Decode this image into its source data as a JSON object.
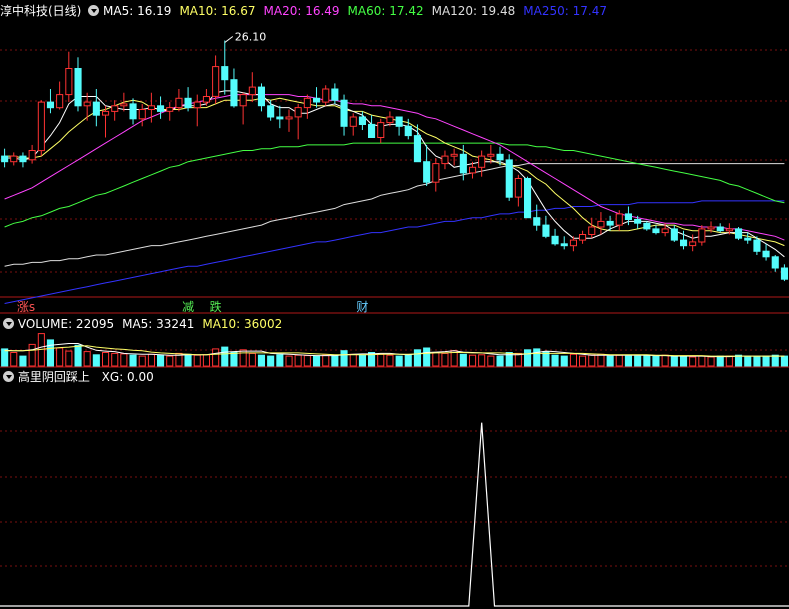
{
  "main": {
    "title": "淳中科技(日线)",
    "ma_items": [
      {
        "label": "MA5: 16.19",
        "color": "#ffffff"
      },
      {
        "label": "MA10: 16.67",
        "color": "#ffff66"
      },
      {
        "label": "MA20: 16.49",
        "color": "#ff44ff"
      },
      {
        "label": "MA60: 17.42",
        "color": "#44ff44"
      },
      {
        "label": "MA120: 19.48",
        "color": "#dddddd"
      },
      {
        "label": "MA250: 17.47",
        "color": "#3333ff"
      }
    ],
    "high_label": "26.10",
    "markers": [
      {
        "text": "涨",
        "extra": "s",
        "index": 2,
        "color": "#ff5555"
      },
      {
        "text": "减",
        "index": 20,
        "color": "#55ee55"
      },
      {
        "text": "跌",
        "index": 23,
        "color": "#55ee55"
      },
      {
        "text": "财",
        "index": 39,
        "color": "#66ccff"
      }
    ]
  },
  "volume_panel": {
    "items": [
      {
        "label": "VOLUME: 22095",
        "color": "#ffffff"
      },
      {
        "label": "MA5: 33241",
        "color": "#ffffff"
      },
      {
        "label": "MA10: 36002",
        "color": "#ffff66"
      }
    ]
  },
  "indicator_panel": {
    "name": "高里阴回踩上",
    "items": [
      {
        "label": "XG: 0.00",
        "color": "#ffffff"
      }
    ]
  },
  "colors": {
    "up": "#ff3333",
    "down": "#54fcfc",
    "grid": "#7a1010",
    "divider": "#b01818"
  },
  "chart_data": {
    "type": "candlestick",
    "candles": [
      [
        19.9,
        20.3,
        19.3,
        19.6
      ],
      [
        19.6,
        20.1,
        19.4,
        19.9
      ],
      [
        19.9,
        20.1,
        19.3,
        19.6
      ],
      [
        19.7,
        20.5,
        19.5,
        20.2
      ],
      [
        20.2,
        22.9,
        19.9,
        22.8
      ],
      [
        22.8,
        23.5,
        22.2,
        22.5
      ],
      [
        22.5,
        23.9,
        22.4,
        23.2
      ],
      [
        23.2,
        25.5,
        22.8,
        24.6
      ],
      [
        24.6,
        25.2,
        22.3,
        22.6
      ],
      [
        22.6,
        23.3,
        21.8,
        22.8
      ],
      [
        22.8,
        23.5,
        21.5,
        22.1
      ],
      [
        22.1,
        22.6,
        20.9,
        22.3
      ],
      [
        22.3,
        22.9,
        21.8,
        22.6
      ],
      [
        22.6,
        23.3,
        22.3,
        22.7
      ],
      [
        22.7,
        23.0,
        21.6,
        21.9
      ],
      [
        21.9,
        22.7,
        21.5,
        22.4
      ],
      [
        22.4,
        23.3,
        21.7,
        22.6
      ],
      [
        22.6,
        23.1,
        21.9,
        22.3
      ],
      [
        22.3,
        22.8,
        21.8,
        22.5
      ],
      [
        22.5,
        23.5,
        22.3,
        23.0
      ],
      [
        23.0,
        23.6,
        22.3,
        22.5
      ],
      [
        22.5,
        23.2,
        21.5,
        22.8
      ],
      [
        22.8,
        23.5,
        22.6,
        23.1
      ],
      [
        23.1,
        25.3,
        22.7,
        24.7
      ],
      [
        24.7,
        26.1,
        23.2,
        24.0
      ],
      [
        24.0,
        24.6,
        22.5,
        22.6
      ],
      [
        22.6,
        23.3,
        21.6,
        23.2
      ],
      [
        23.2,
        24.4,
        22.8,
        23.6
      ],
      [
        23.6,
        23.8,
        22.3,
        22.6
      ],
      [
        22.6,
        22.9,
        21.8,
        22.0
      ],
      [
        22.0,
        22.6,
        21.4,
        21.9
      ],
      [
        21.9,
        22.4,
        21.2,
        22.0
      ],
      [
        22.0,
        22.7,
        20.8,
        22.5
      ],
      [
        22.5,
        23.2,
        21.9,
        23.0
      ],
      [
        23.0,
        23.6,
        22.5,
        22.8
      ],
      [
        22.8,
        23.7,
        22.6,
        23.5
      ],
      [
        23.5,
        23.8,
        22.7,
        22.9
      ],
      [
        22.9,
        23.2,
        21.0,
        21.5
      ],
      [
        21.5,
        22.2,
        21.0,
        22.0
      ],
      [
        22.0,
        22.3,
        21.3,
        21.6
      ],
      [
        21.6,
        22.1,
        20.9,
        20.9
      ],
      [
        20.9,
        21.9,
        20.6,
        21.7
      ],
      [
        21.7,
        22.3,
        21.5,
        22.0
      ],
      [
        22.0,
        22.0,
        21.0,
        21.5
      ],
      [
        21.5,
        21.9,
        20.8,
        21.0
      ],
      [
        21.0,
        21.6,
        19.6,
        19.6
      ],
      [
        19.6,
        20.5,
        18.3,
        18.5
      ],
      [
        18.5,
        19.8,
        18.0,
        19.5
      ],
      [
        19.5,
        20.2,
        19.2,
        19.9
      ],
      [
        19.9,
        20.3,
        19.4,
        20.0
      ],
      [
        20.0,
        20.5,
        18.6,
        19.0
      ],
      [
        19.0,
        19.6,
        18.7,
        19.3
      ],
      [
        19.3,
        20.2,
        18.8,
        19.9
      ],
      [
        19.9,
        20.5,
        19.5,
        20.0
      ],
      [
        20.0,
        20.4,
        19.4,
        19.7
      ],
      [
        19.7,
        20.0,
        17.5,
        17.7
      ],
      [
        17.7,
        18.9,
        17.2,
        18.7
      ],
      [
        18.7,
        18.8,
        16.6,
        16.6
      ],
      [
        16.6,
        17.3,
        15.9,
        16.2
      ],
      [
        16.2,
        16.7,
        15.5,
        15.6
      ],
      [
        15.6,
        16.0,
        15.1,
        15.2
      ],
      [
        15.2,
        15.6,
        14.9,
        15.1
      ],
      [
        15.1,
        15.6,
        14.8,
        15.4
      ],
      [
        15.4,
        15.9,
        15.2,
        15.7
      ],
      [
        15.7,
        16.6,
        15.5,
        16.1
      ],
      [
        16.1,
        16.9,
        15.7,
        16.4
      ],
      [
        16.4,
        16.7,
        15.9,
        16.2
      ],
      [
        16.2,
        17.0,
        15.9,
        16.8
      ],
      [
        16.8,
        17.2,
        16.2,
        16.5
      ],
      [
        16.5,
        16.7,
        16.0,
        16.3
      ],
      [
        16.3,
        16.4,
        15.9,
        16.0
      ],
      [
        16.0,
        16.2,
        15.7,
        15.8
      ],
      [
        15.8,
        16.3,
        15.6,
        16.0
      ],
      [
        16.0,
        16.2,
        15.3,
        15.4
      ],
      [
        15.4,
        15.9,
        14.9,
        15.1
      ],
      [
        15.1,
        15.7,
        14.8,
        15.3
      ],
      [
        15.3,
        16.2,
        15.1,
        16.0
      ],
      [
        16.0,
        16.4,
        15.8,
        16.1
      ],
      [
        16.1,
        16.3,
        15.8,
        15.9
      ],
      [
        15.9,
        16.3,
        15.7,
        16.0
      ],
      [
        16.0,
        16.1,
        15.4,
        15.5
      ],
      [
        15.5,
        15.8,
        15.2,
        15.4
      ],
      [
        15.4,
        15.6,
        14.6,
        14.8
      ],
      [
        14.8,
        15.2,
        14.3,
        14.5
      ],
      [
        14.5,
        14.6,
        13.7,
        13.9
      ],
      [
        13.9,
        14.1,
        13.2,
        13.3
      ]
    ],
    "ma5": [
      19.8,
      19.8,
      19.7,
      19.8,
      20.4,
      21.0,
      21.7,
      22.7,
      23.1,
      23.1,
      23.1,
      22.6,
      22.5,
      22.4,
      22.4,
      22.4,
      22.5,
      22.4,
      22.3,
      22.6,
      22.6,
      22.6,
      22.7,
      23.3,
      23.4,
      23.4,
      23.3,
      23.2,
      23.2,
      22.7,
      22.5,
      22.5,
      22.2,
      22.2,
      22.4,
      22.6,
      22.7,
      22.5,
      22.3,
      22.1,
      21.6,
      21.5,
      21.6,
      21.6,
      21.5,
      21.2,
      20.4,
      19.9,
      19.7,
      19.3,
      19.4,
      19.5,
      19.6,
      19.6,
      19.6,
      19.4,
      19.1,
      18.6,
      17.8,
      17.0,
      16.4,
      15.9,
      15.5,
      15.5,
      15.5,
      15.7,
      16.0,
      16.2,
      16.4,
      16.4,
      16.4,
      16.3,
      16.2,
      15.9,
      15.7,
      15.5,
      15.6,
      15.6,
      15.7,
      15.8,
      15.8,
      15.8,
      15.5,
      15.2,
      14.9,
      14.5
    ],
    "ma10": [
      19.9,
      19.9,
      19.8,
      19.8,
      19.9,
      20.3,
      20.7,
      21.2,
      21.6,
      22.0,
      22.3,
      22.4,
      22.6,
      22.8,
      22.9,
      22.8,
      22.5,
      22.4,
      22.4,
      22.4,
      22.5,
      22.5,
      22.5,
      22.7,
      22.9,
      22.9,
      22.9,
      22.9,
      23.0,
      22.9,
      23.0,
      22.9,
      22.8,
      22.7,
      22.6,
      22.6,
      22.6,
      22.4,
      22.3,
      22.3,
      22.1,
      22.0,
      21.9,
      21.8,
      21.7,
      21.4,
      21.1,
      20.9,
      20.6,
      20.4,
      20.2,
      19.9,
      19.8,
      19.7,
      19.5,
      19.4,
      19.3,
      19.1,
      18.7,
      18.4,
      17.9,
      17.5,
      17.1,
      16.6,
      16.2,
      16.0,
      15.9,
      15.9,
      15.9,
      16.0,
      16.1,
      16.2,
      16.2,
      16.2,
      16.0,
      15.9,
      15.9,
      15.9,
      15.8,
      15.8,
      15.7,
      15.6,
      15.5,
      15.4,
      15.3,
      15.1
    ],
    "ma20": [
      17.6,
      17.8,
      18.0,
      18.2,
      18.5,
      18.8,
      19.1,
      19.4,
      19.7,
      20.0,
      20.3,
      20.6,
      20.9,
      21.2,
      21.5,
      21.8,
      22.0,
      22.2,
      22.4,
      22.6,
      22.7,
      22.8,
      22.9,
      23.0,
      23.1,
      23.2,
      23.2,
      23.2,
      23.2,
      23.2,
      23.2,
      23.2,
      23.1,
      23.1,
      23.0,
      22.9,
      22.9,
      22.8,
      22.7,
      22.7,
      22.6,
      22.6,
      22.5,
      22.4,
      22.3,
      22.2,
      22.0,
      21.9,
      21.7,
      21.5,
      21.3,
      21.1,
      20.9,
      20.7,
      20.5,
      20.2,
      19.9,
      19.6,
      19.3,
      19.0,
      18.7,
      18.4,
      18.1,
      17.8,
      17.5,
      17.2,
      17.0,
      16.8,
      16.7,
      16.6,
      16.5,
      16.4,
      16.3,
      16.3,
      16.2,
      16.2,
      16.1,
      16.1,
      16.1,
      16.0,
      16.0,
      15.9,
      15.8,
      15.7,
      15.6,
      15.4
    ],
    "ma60": [
      16.1,
      16.3,
      16.4,
      16.6,
      16.7,
      16.9,
      17.1,
      17.2,
      17.4,
      17.6,
      17.8,
      17.9,
      18.1,
      18.3,
      18.5,
      18.7,
      18.9,
      19.1,
      19.3,
      19.4,
      19.6,
      19.7,
      19.8,
      19.9,
      20.0,
      20.1,
      20.2,
      20.2,
      20.3,
      20.3,
      20.4,
      20.4,
      20.4,
      20.5,
      20.5,
      20.5,
      20.5,
      20.5,
      20.6,
      20.6,
      20.6,
      20.6,
      20.6,
      20.6,
      20.6,
      20.6,
      20.6,
      20.6,
      20.6,
      20.6,
      20.6,
      20.6,
      20.6,
      20.6,
      20.6,
      20.5,
      20.5,
      20.5,
      20.4,
      20.4,
      20.3,
      20.2,
      20.2,
      20.1,
      20.0,
      19.9,
      19.8,
      19.7,
      19.6,
      19.5,
      19.4,
      19.3,
      19.2,
      19.1,
      19.0,
      18.9,
      18.8,
      18.7,
      18.6,
      18.4,
      18.3,
      18.1,
      17.9,
      17.7,
      17.5,
      17.4
    ],
    "ma120": [
      14.0,
      14.1,
      14.1,
      14.2,
      14.2,
      14.3,
      14.3,
      14.4,
      14.4,
      14.5,
      14.6,
      14.6,
      14.7,
      14.8,
      14.9,
      15.0,
      15.1,
      15.1,
      15.2,
      15.3,
      15.4,
      15.5,
      15.6,
      15.7,
      15.8,
      15.9,
      16.0,
      16.1,
      16.2,
      16.4,
      16.5,
      16.6,
      16.7,
      16.8,
      16.9,
      17.0,
      17.1,
      17.3,
      17.4,
      17.5,
      17.6,
      17.8,
      17.9,
      18.0,
      18.1,
      18.3,
      18.4,
      18.6,
      18.7,
      18.8,
      18.9,
      19.0,
      19.1,
      19.2,
      19.3,
      19.4,
      19.4,
      19.5,
      19.5,
      19.5,
      19.5,
      19.5,
      19.5,
      19.5,
      19.5,
      19.5,
      19.5,
      19.5,
      19.5,
      19.5,
      19.5,
      19.5,
      19.5,
      19.5,
      19.5,
      19.5,
      19.5,
      19.5,
      19.5,
      19.5,
      19.5,
      19.5,
      19.5,
      19.5,
      19.5,
      19.5
    ],
    "ma250": [
      12.0,
      12.1,
      12.2,
      12.3,
      12.4,
      12.5,
      12.6,
      12.7,
      12.8,
      12.9,
      13.0,
      13.1,
      13.2,
      13.3,
      13.4,
      13.5,
      13.6,
      13.7,
      13.8,
      13.9,
      14.0,
      14.0,
      14.1,
      14.2,
      14.3,
      14.4,
      14.5,
      14.6,
      14.7,
      14.8,
      14.9,
      15.0,
      15.1,
      15.2,
      15.3,
      15.3,
      15.4,
      15.5,
      15.6,
      15.7,
      15.8,
      15.8,
      15.9,
      16.0,
      16.1,
      16.1,
      16.2,
      16.3,
      16.4,
      16.4,
      16.5,
      16.6,
      16.6,
      16.7,
      16.8,
      16.8,
      16.9,
      16.9,
      17.0,
      17.0,
      17.1,
      17.1,
      17.2,
      17.2,
      17.2,
      17.3,
      17.3,
      17.3,
      17.3,
      17.4,
      17.4,
      17.4,
      17.4,
      17.4,
      17.4,
      17.4,
      17.5,
      17.5,
      17.5,
      17.5,
      17.5,
      17.5,
      17.5,
      17.5,
      17.5,
      17.5
    ],
    "volume": [
      38,
      30,
      22,
      48,
      72,
      58,
      40,
      33,
      46,
      32,
      25,
      30,
      28,
      27,
      24,
      22,
      26,
      24,
      22,
      28,
      26,
      24,
      25,
      38,
      42,
      30,
      36,
      28,
      24,
      22,
      25,
      22,
      24,
      23,
      22,
      24,
      23,
      34,
      26,
      24,
      30,
      26,
      24,
      22,
      25,
      36,
      40,
      30,
      28,
      34,
      26,
      24,
      25,
      22,
      22,
      30,
      28,
      36,
      38,
      32,
      24,
      22,
      26,
      22,
      24,
      26,
      22,
      24,
      22,
      22,
      24,
      22,
      24,
      20,
      22,
      20,
      22,
      20,
      22,
      22,
      24,
      22,
      20,
      22,
      24,
      22
    ],
    "vol_ma5": [
      35,
      34,
      34,
      36,
      42,
      46,
      48,
      50,
      50,
      42,
      35,
      33,
      32,
      28,
      27,
      26,
      26,
      25,
      24,
      24,
      25,
      25,
      25,
      28,
      31,
      32,
      33,
      33,
      33,
      28,
      27,
      26,
      25,
      24,
      23,
      23,
      23,
      25,
      26,
      27,
      27,
      28,
      28,
      26,
      25,
      27,
      30,
      31,
      32,
      34,
      31,
      30,
      29,
      27,
      25,
      25,
      25,
      27,
      30,
      33,
      32,
      30,
      28,
      26,
      24,
      24,
      24,
      24,
      24,
      24,
      24,
      23,
      23,
      22,
      22,
      22,
      22,
      21,
      21,
      21,
      22,
      22,
      22,
      22,
      22,
      22
    ],
    "vol_ma10": [
      34,
      34,
      34,
      35,
      37,
      39,
      41,
      42,
      44,
      45,
      42,
      40,
      38,
      37,
      35,
      34,
      31,
      29,
      28,
      27,
      26,
      25,
      25,
      26,
      27,
      28,
      29,
      29,
      29,
      29,
      29,
      29,
      29,
      28,
      27,
      26,
      25,
      25,
      25,
      25,
      25,
      26,
      26,
      26,
      26,
      27,
      28,
      29,
      29,
      30,
      30,
      29,
      29,
      29,
      29,
      28,
      27,
      27,
      28,
      28,
      28,
      28,
      28,
      28,
      27,
      26,
      25,
      25,
      25,
      25,
      25,
      24,
      24,
      23,
      23,
      23,
      23,
      22,
      22,
      22,
      22,
      22,
      22,
      22,
      22,
      22
    ],
    "xg": {
      "signal_index": 52,
      "value": 1,
      "current": 0.0
    }
  }
}
